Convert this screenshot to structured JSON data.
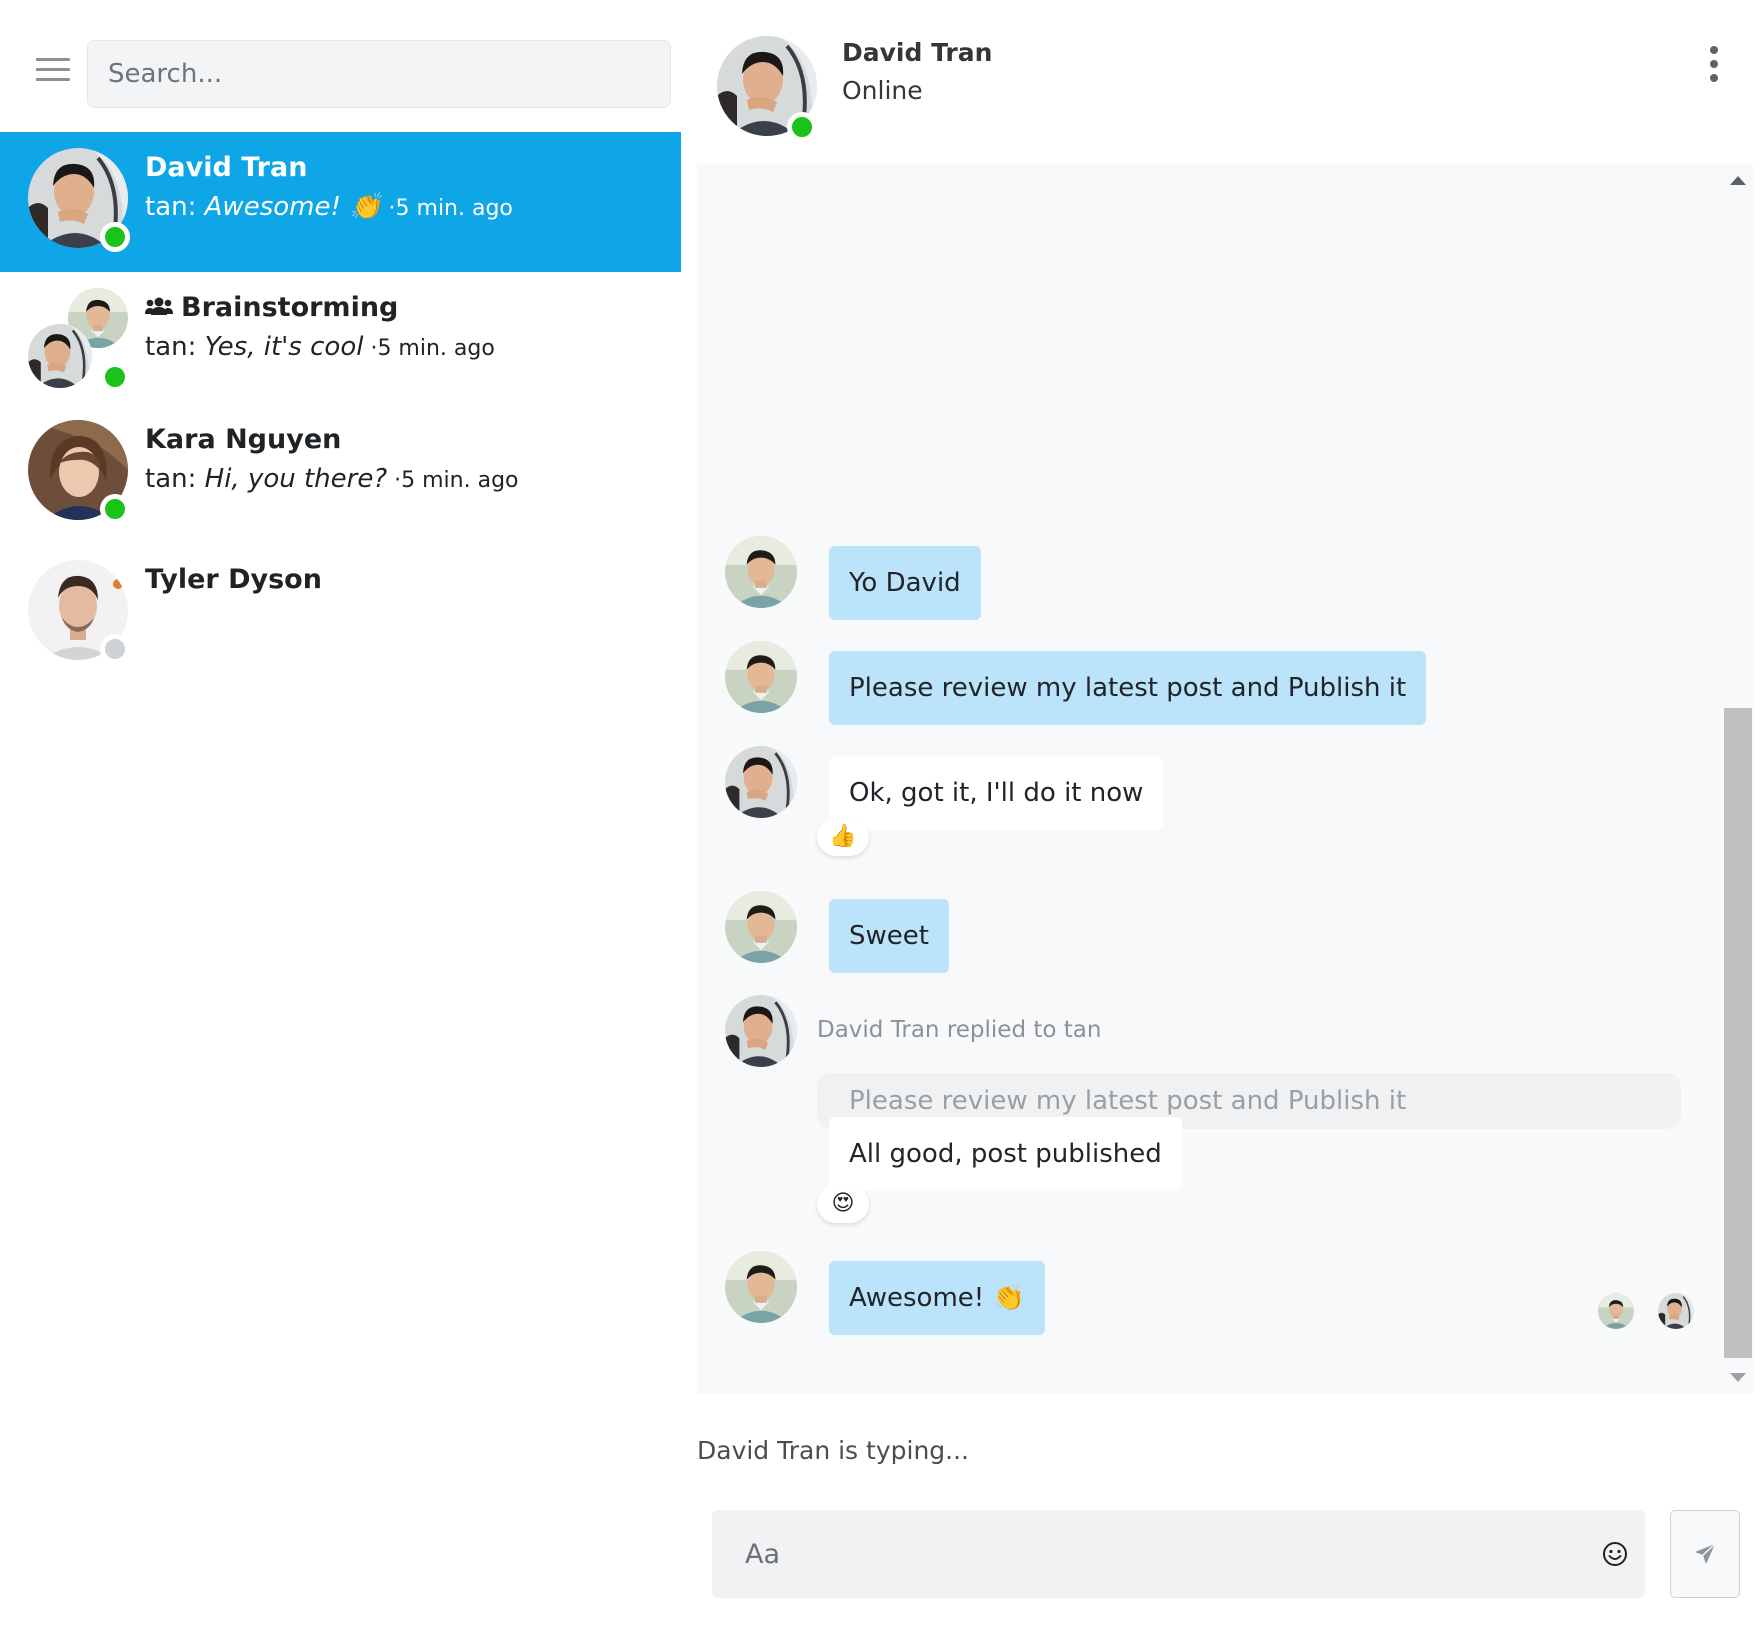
{
  "colors": {
    "active_contact_bg": "#0ea6e6",
    "online": "#1ac21a",
    "offline": "#cfd2d4",
    "my_bubble": "#bbe3fa",
    "their_bubble": "#ffffff"
  },
  "sidebar": {
    "menu_icon": "hamburger-icon",
    "search_placeholder": "Search...",
    "contacts": [
      {
        "name": "David Tran",
        "sender": "tan: ",
        "last_message": "Awesome! 👏",
        "ago": " ·5 min. ago",
        "status": "online",
        "active": true
      },
      {
        "name": "Brainstorming",
        "sender": "tan: ",
        "last_message": "Yes, it's cool",
        "ago": " ·5 min. ago",
        "status": "online",
        "is_group": true,
        "group_icon": "users-icon"
      },
      {
        "name": "Kara Nguyen",
        "sender": "tan: ",
        "last_message": "Hi, you there?",
        "ago": " ·5 min. ago",
        "status": "online"
      },
      {
        "name": "Tyler Dyson",
        "status": "offline"
      }
    ]
  },
  "chat": {
    "title": "David Tran",
    "status": "Online",
    "menu_icon": "kebab-menu-icon",
    "messages": [
      {
        "author": "tan",
        "text": "Yo David"
      },
      {
        "author": "David Tran",
        "text": "Please review my latest post and Publish it"
      },
      {
        "author": "tan",
        "text": "Ok, got it, I'll do it now",
        "reaction": "👍"
      },
      {
        "author": "David Tran",
        "text": "Sweet"
      },
      {
        "author": "tan",
        "reply_label": "David Tran replied to tan",
        "quoted": "Please review my latest post and Publish it",
        "text": "All good, post published",
        "reaction": "😍"
      },
      {
        "author": "David Tran",
        "text": "Awesome! 👏"
      }
    ],
    "typing_indicator": "David Tran is typing...",
    "composer_placeholder": "Aa",
    "emoji_icon": "smiley-icon",
    "send_icon": "paper-plane-icon"
  }
}
